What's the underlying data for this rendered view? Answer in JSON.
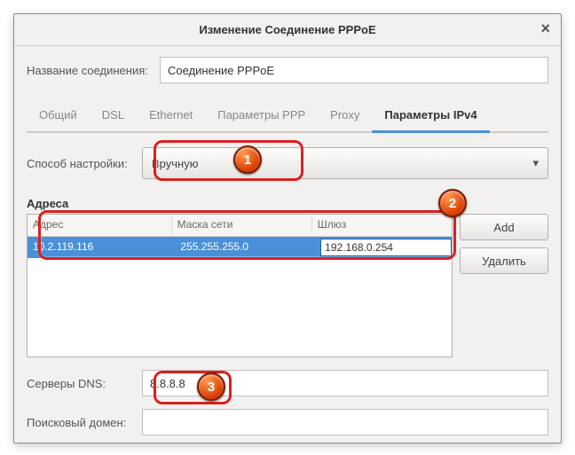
{
  "title": "Изменение Соединение PPPoE",
  "name_label": "Название соединения:",
  "name_value": "Соединение PPPoE",
  "tabs": [
    "Общий",
    "DSL",
    "Ethernet",
    "Параметры PPP",
    "Proxy",
    "Параметры IPv4"
  ],
  "active_tab": 5,
  "method_label": "Способ настройки:",
  "method_value": "Вручную",
  "addresses_title": "Адреса",
  "addr_cols": {
    "address": "Адрес",
    "mask": "Маска сети",
    "gw": "Шлюз"
  },
  "addr_rows": [
    {
      "address": "10.2.119.116",
      "mask": "255.255.255.0",
      "gw": "192.168.0.254"
    }
  ],
  "buttons": {
    "add": "Add",
    "delete": "Удалить"
  },
  "dns_label": "Серверы DNS:",
  "dns_value": "8.8.8.8",
  "search_label": "Поисковый домен:",
  "search_value": "",
  "callouts": {
    "1": "1",
    "2": "2",
    "3": "3"
  }
}
